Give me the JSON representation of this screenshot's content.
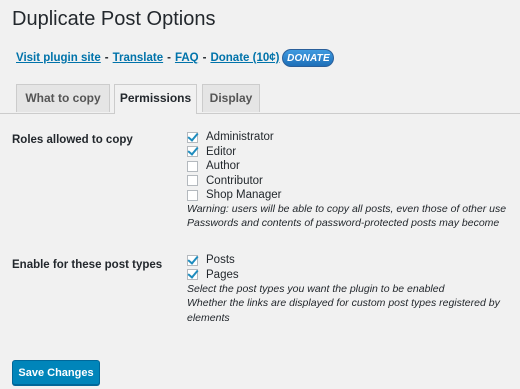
{
  "page": {
    "title": "Duplicate Post Options"
  },
  "links": {
    "visit": "Visit plugin site",
    "translate": "Translate",
    "faq": "FAQ",
    "donate": "Donate (10¢)",
    "separator": "-",
    "donate_badge": "DONATE"
  },
  "tabs": [
    {
      "label": "What to copy",
      "active": false
    },
    {
      "label": "Permissions",
      "active": true
    },
    {
      "label": "Display",
      "active": false
    }
  ],
  "roles": {
    "label": "Roles allowed to copy",
    "items": [
      {
        "label": "Administrator",
        "checked": true
      },
      {
        "label": "Editor",
        "checked": true
      },
      {
        "label": "Author",
        "checked": false
      },
      {
        "label": "Contributor",
        "checked": false
      },
      {
        "label": "Shop Manager",
        "checked": false
      }
    ],
    "desc": [
      "Warning: users will be able to copy all posts, even those of other use",
      "Passwords and contents of password-protected posts may become"
    ]
  },
  "post_types": {
    "label": "Enable for these post types",
    "items": [
      {
        "label": "Posts",
        "checked": true
      },
      {
        "label": "Pages",
        "checked": true
      }
    ],
    "desc": [
      "Select the post types you want the plugin to be enabled",
      "Whether the links are displayed for custom post types registered by",
      "elements"
    ]
  },
  "save_button": "Save Changes",
  "colors": {
    "link": "#0073aa",
    "primary_button": "#0085ba",
    "checkmark": "#1e8cbe",
    "background": "#f1f1f1"
  }
}
